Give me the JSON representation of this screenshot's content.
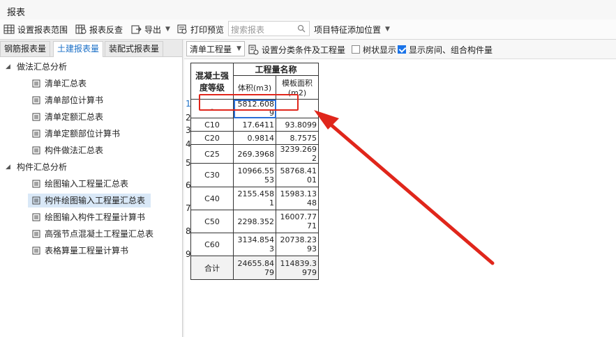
{
  "window": {
    "title": "报表"
  },
  "toolbar": {
    "set_range": "设置报表范围",
    "reverse_check": "报表反查",
    "export": "导出",
    "print_preview": "打印预览",
    "search_placeholder": "搜索报表",
    "feature_position": "项目特征添加位置"
  },
  "tabs": [
    "钢筋报表量",
    "土建报表量",
    "装配式报表量"
  ],
  "tree": {
    "group1": "做法汇总分析",
    "group1_items": [
      "清单汇总表",
      "清单部位计算书",
      "清单定额汇总表",
      "清单定额部位计算书",
      "构件做法汇总表"
    ],
    "group2": "构件汇总分析",
    "group2_items": [
      "绘图输入工程量汇总表",
      "构件绘图输入工程量汇总表",
      "绘图输入构件工程量计算书",
      "高强节点混凝土工程量汇总表",
      "表格算量工程量计算书"
    ]
  },
  "report_toolbar": {
    "mode_select": "清单工程量",
    "set_filter": "设置分类条件及工程量",
    "tree_display": "树状显示",
    "tree_display_checked": false,
    "show_rooms": "显示房间、组合构件量",
    "show_rooms_checked": true
  },
  "table": {
    "col1_header": "混凝土强度等级",
    "group_header": "工程量名称",
    "col2_header": "体积(m3)",
    "col3_header": "模板面积(m2)",
    "rows": [
      {
        "num": "1",
        "grade": "-",
        "volume": "5812.6089",
        "formwork": ""
      },
      {
        "num": "2",
        "grade": "C10",
        "volume": "17.6411",
        "formwork": "93.8099"
      },
      {
        "num": "3",
        "grade": "C20",
        "volume": "0.9814",
        "formwork": "8.7575"
      },
      {
        "num": "4",
        "grade": "C25",
        "volume": "269.3968",
        "formwork": "3239.2692"
      },
      {
        "num": "5",
        "grade": "C30",
        "volume": "10966.5553",
        "formwork": "58768.4101"
      },
      {
        "num": "6",
        "grade": "C40",
        "volume": "2155.4581",
        "formwork": "15983.1348"
      },
      {
        "num": "7",
        "grade": "C50",
        "volume": "2298.352",
        "formwork": "16007.7771"
      },
      {
        "num": "8",
        "grade": "C60",
        "volume": "3134.8543",
        "formwork": "20738.2393"
      },
      {
        "num": "9",
        "grade": "合计",
        "volume": "24655.8479",
        "formwork": "114839.3979"
      }
    ]
  },
  "colors": {
    "accent": "#1a6fc7",
    "annotation": "#e0261b",
    "selection": "#d9e8f7"
  }
}
